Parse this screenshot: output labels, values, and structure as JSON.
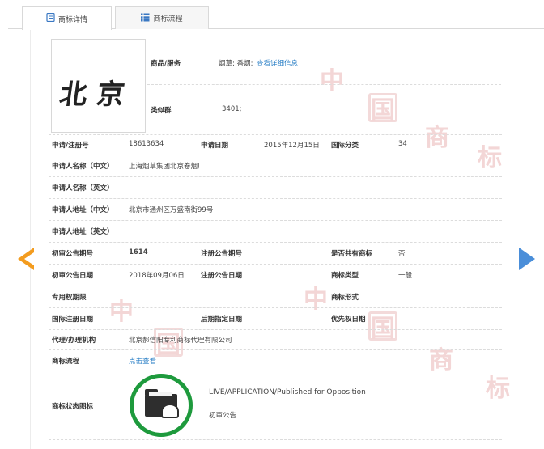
{
  "tabs": [
    {
      "label": "商标详情",
      "icon": "document-icon",
      "active": true
    },
    {
      "label": "商标流程",
      "icon": "list-icon",
      "active": false
    }
  ],
  "mark": {
    "text": "北京"
  },
  "goods": {
    "label": "商品/服务",
    "value": "烟草; 香烟;",
    "link": "查看详细信息"
  },
  "similar_group": {
    "label": "类似群",
    "value": "3401;"
  },
  "rows": {
    "reg_no": {
      "label": "申请/注册号",
      "value": "18613634"
    },
    "app_date": {
      "label": "申请日期",
      "value": "2015年12月15日"
    },
    "intl_class": {
      "label": "国际分类",
      "value": "34"
    },
    "applicant_cn": {
      "label": "申请人名称（中文）",
      "value": "上海烟草集团北京卷烟厂"
    },
    "applicant_en": {
      "label": "申请人名称（英文）",
      "value": ""
    },
    "address_cn": {
      "label": "申请人地址（中文）",
      "value": "北京市通州区万盛南街99号"
    },
    "address_en": {
      "label": "申请人地址（英文）",
      "value": ""
    },
    "prelim_no": {
      "label": "初审公告期号",
      "value": "1614"
    },
    "reg_pub_no": {
      "label": "注册公告期号",
      "value": ""
    },
    "shared": {
      "label": "是否共有商标",
      "value": "否"
    },
    "prelim_date": {
      "label": "初审公告日期",
      "value": "2018年09月06日"
    },
    "reg_pub_date": {
      "label": "注册公告日期",
      "value": ""
    },
    "mark_type": {
      "label": "商标类型",
      "value": "一般"
    },
    "exclusive_period": {
      "label": "专用权期限",
      "value": ""
    },
    "mark_form": {
      "label": "商标形式",
      "value": ""
    },
    "intl_reg_date": {
      "label": "国际注册日期",
      "value": ""
    },
    "later_date": {
      "label": "后期指定日期",
      "value": ""
    },
    "priority_date": {
      "label": "优先权日期",
      "value": ""
    },
    "agent": {
      "label": "代理/办理机构",
      "value": "北京郝信阳专利商标代理有限公司"
    },
    "flow": {
      "label": "商标流程",
      "link": "点击查看"
    },
    "status": {
      "label": "商标状态图标",
      "english": "LIVE/APPLICATION/Published for Opposition",
      "chinese": "初审公告"
    }
  },
  "colors": {
    "accent_link": "#2a7fc6",
    "prev_arrow": "#f39c1f",
    "next_arrow": "#4a8ed9",
    "status_ring": "#1e9a3d"
  }
}
